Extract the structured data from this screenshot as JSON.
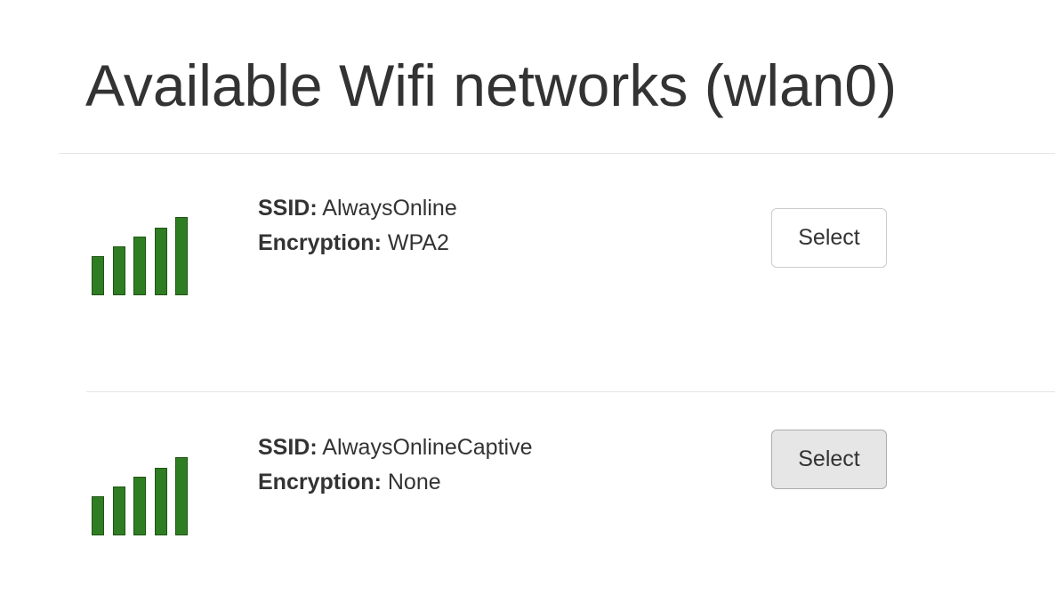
{
  "page": {
    "title": "Available Wifi networks (wlan0)"
  },
  "labels": {
    "ssid": "SSID:",
    "encryption": "Encryption:"
  },
  "networks": [
    {
      "ssid": "AlwaysOnline",
      "encryption": "WPA2",
      "select_label": "Select",
      "signal_bars": 5,
      "button_state": "default"
    },
    {
      "ssid": "AlwaysOnlineCaptive",
      "encryption": "None",
      "select_label": "Select",
      "signal_bars": 5,
      "button_state": "hover"
    }
  ],
  "colors": {
    "signal": "#2f7d22",
    "text": "#333333",
    "divider": "#e5e5e5"
  },
  "icons": {
    "signal": "signal-strength-icon"
  }
}
